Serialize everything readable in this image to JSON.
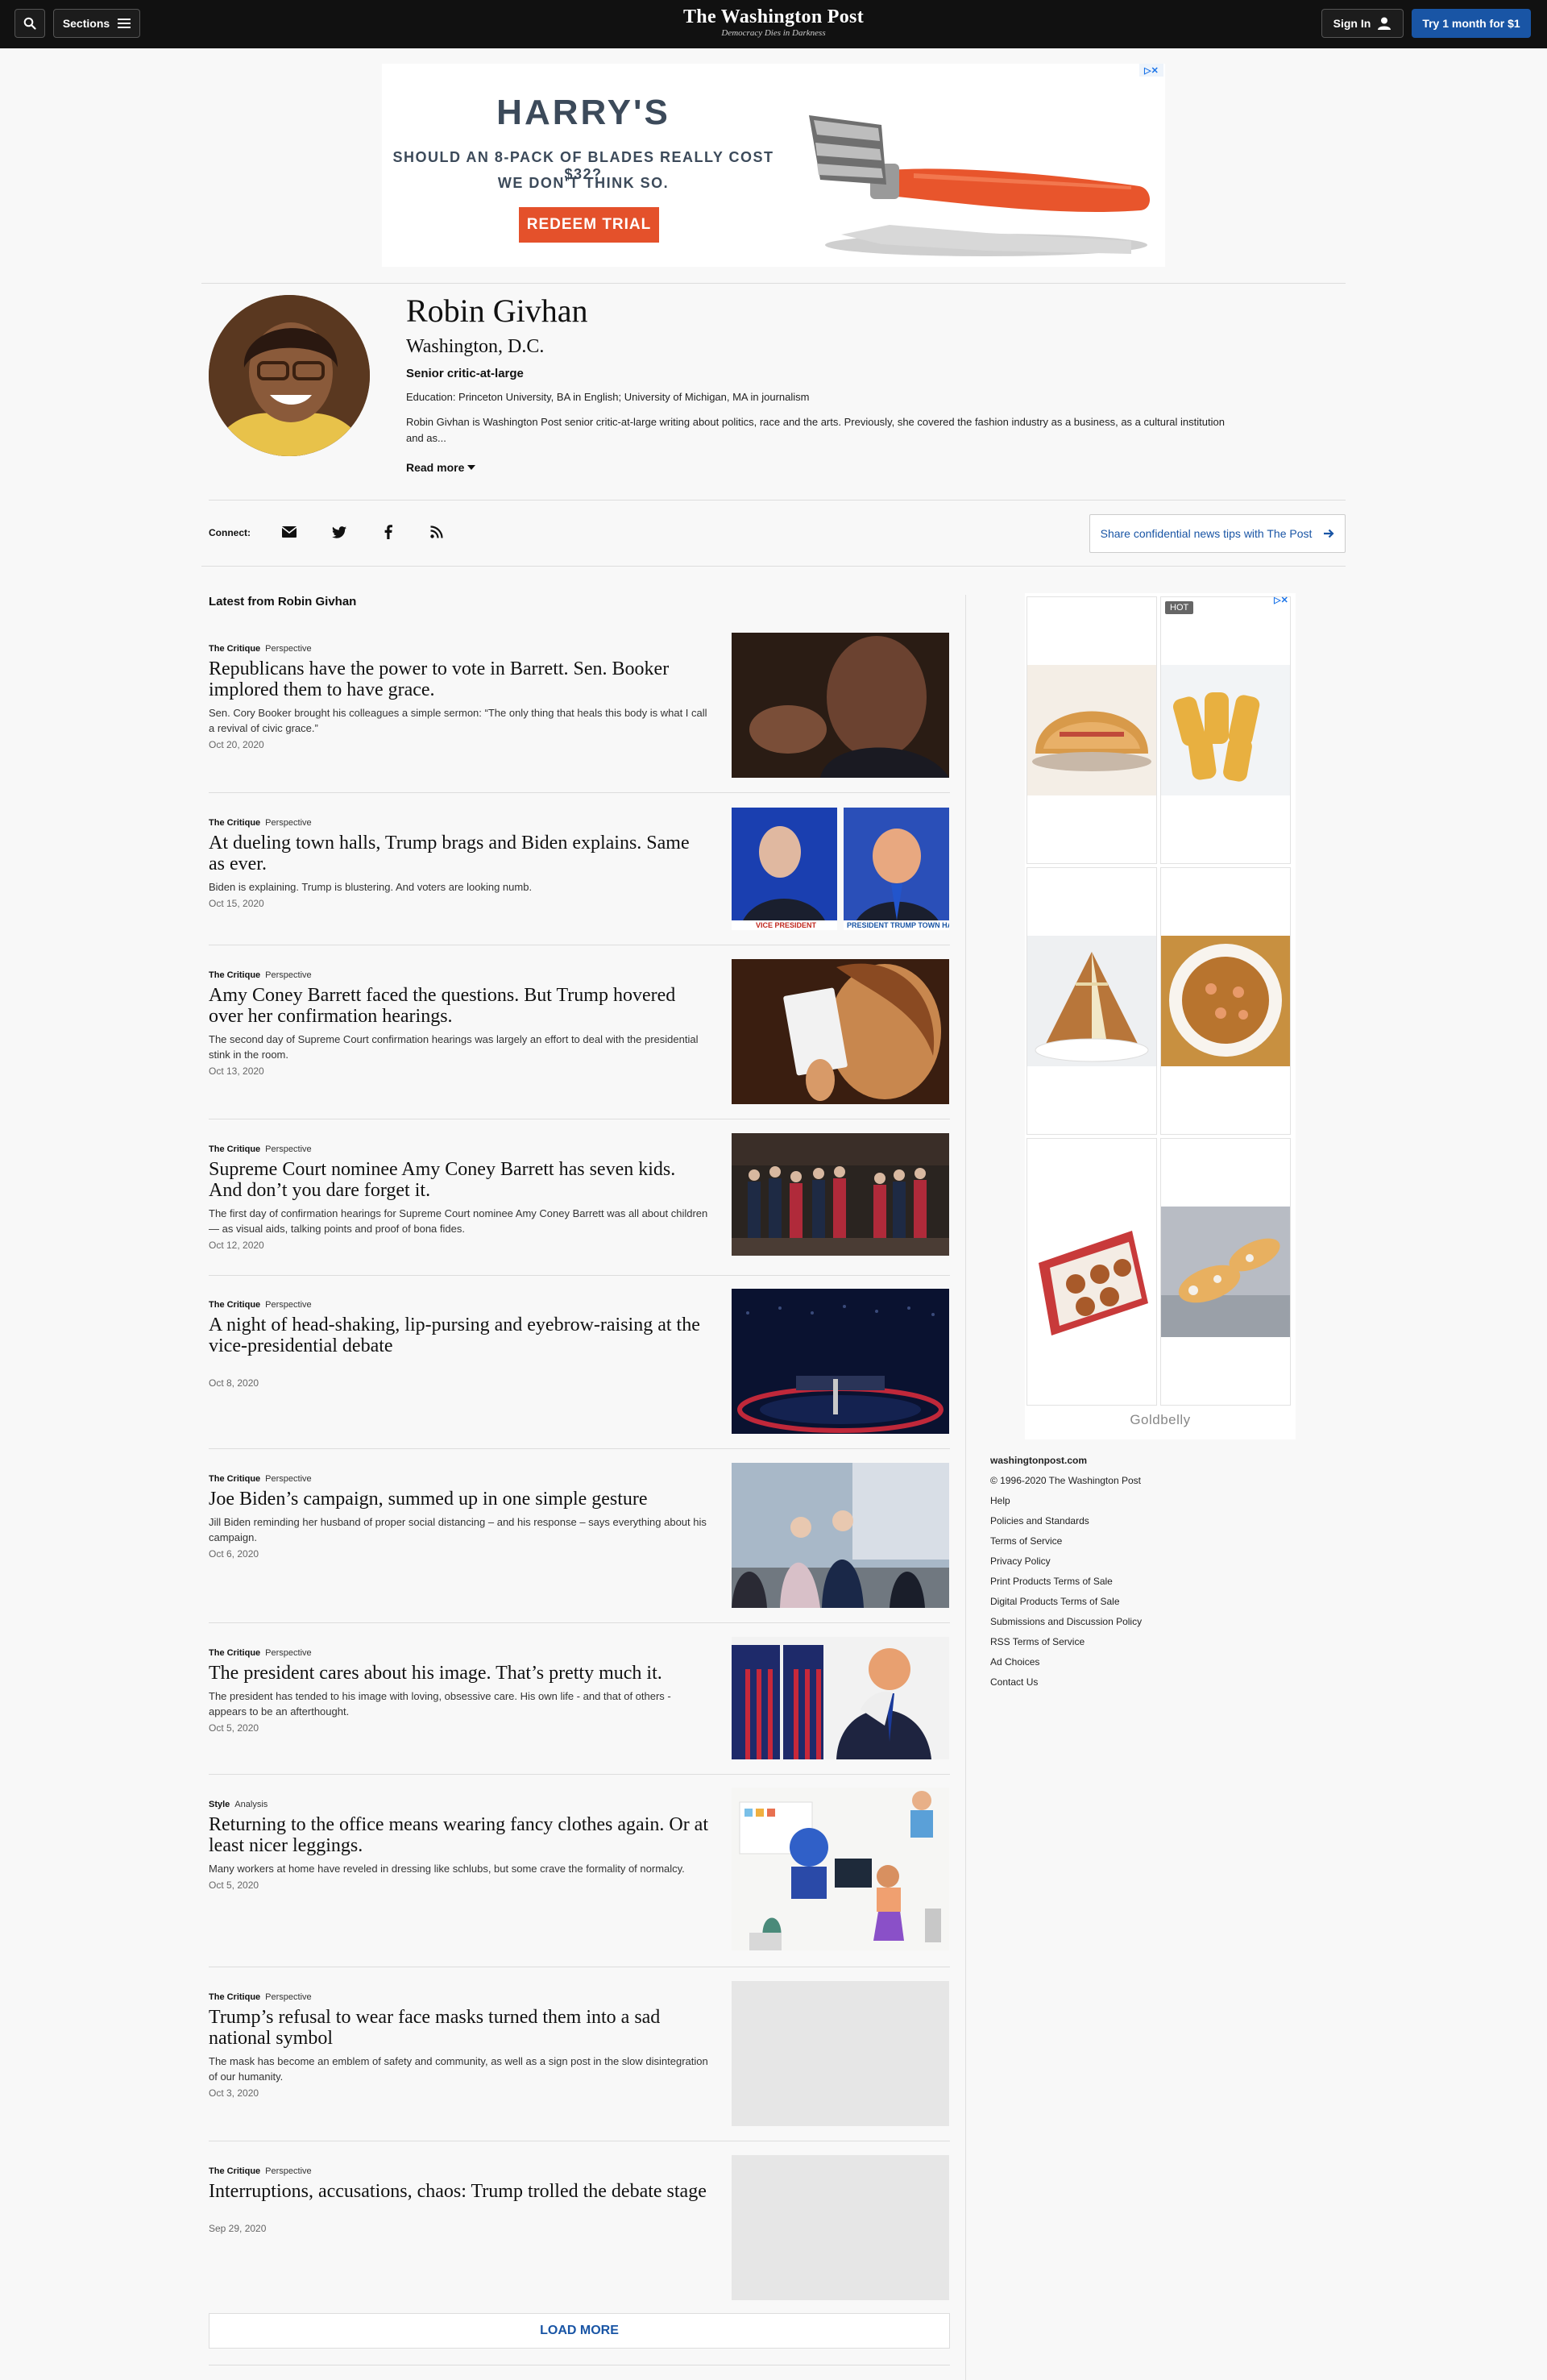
{
  "header": {
    "sections_label": "Sections",
    "logo_name": "The Washington Post",
    "logo_tagline": "Democracy Dies in Darkness",
    "signin_label": "Sign In",
    "trial_label": "Try 1 month for $1"
  },
  "top_ad": {
    "brand": "HARRY'S",
    "line1": "SHOULD AN 8-PACK OF BLADES REALLY COST $32?",
    "line2": "WE DON'T THINK SO.",
    "cta": "REDEEM TRIAL",
    "colors": {
      "cta": "#e4512b",
      "text": "#3c4a5a",
      "handle": "#e8552c"
    }
  },
  "profile": {
    "name": "Robin Givhan",
    "location": "Washington, D.C.",
    "role": "Senior critic-at-large",
    "education": "Education: Princeton University, BA in English; University of Michigan, MA in journalism",
    "bio": "Robin Givhan is Washington Post senior critic-at-large writing about politics, race and the arts. Previously, she covered the fashion industry as a business, as a cultural institution and as...",
    "read_more": "Read more"
  },
  "connect": {
    "label": "Connect:",
    "icons": [
      "email-icon",
      "twitter-icon",
      "facebook-icon",
      "rss-icon"
    ],
    "tips_label": "Share confidential news tips with The Post"
  },
  "latest_heading": "Latest from Robin Givhan",
  "articles": [
    {
      "section": "The Critique",
      "label": "Perspective",
      "headline": "Republicans have the power to vote in Barrett. Sen. Booker implored them to have grace.",
      "blurb": "Sen. Cory Booker brought his colleagues a simple sermon: “The only thing that heals this body is what I call a revival of civic grace.”",
      "date": "Oct 20, 2020"
    },
    {
      "section": "The Critique",
      "label": "Perspective",
      "headline": "At dueling town halls, Trump brags and Biden explains. Same as ever.",
      "blurb": "Biden is explaining. Trump is blustering. And voters are looking numb.",
      "date": "Oct 15, 2020"
    },
    {
      "section": "The Critique",
      "label": "Perspective",
      "headline": "Amy Coney Barrett faced the questions. But Trump hovered over her confirmation hearings.",
      "blurb": "The second day of Supreme Court confirmation hearings was largely an effort to deal with the presidential stink in the room.",
      "date": "Oct 13, 2020"
    },
    {
      "section": "The Critique",
      "label": "Perspective",
      "headline": "Supreme Court nominee Amy Coney Barrett has seven kids. And don’t you dare forget it.",
      "blurb": "The first day of confirmation hearings for Supreme Court nominee Amy Coney Barrett was all about children — as visual aids, talking points and proof of bona fides.",
      "date": "Oct 12, 2020"
    },
    {
      "section": "The Critique",
      "label": "Perspective",
      "headline": "A night of head-shaking, lip-pursing and eyebrow-raising at the vice-presidential debate",
      "blurb": "",
      "date": "Oct 8, 2020"
    },
    {
      "section": "The Critique",
      "label": "Perspective",
      "headline": "Joe Biden’s campaign, summed up in one simple gesture",
      "blurb": "Jill Biden reminding her husband of proper social distancing – and his response – says everything about his campaign.",
      "date": "Oct 6, 2020"
    },
    {
      "section": "The Critique",
      "label": "Perspective",
      "headline": "The president cares about his image. That’s pretty much it.",
      "blurb": "The president has tended to his image with loving, obsessive care. His own life - and that of others - appears to be an afterthought.",
      "date": "Oct 5, 2020"
    },
    {
      "section": "Style",
      "label": "Analysis",
      "headline": "Returning to the office means wearing fancy clothes again. Or at least nicer leggings.",
      "blurb": "Many workers at home have reveled in dressing like schlubs, but some crave the formality of normalcy.",
      "date": "Oct 5, 2020"
    },
    {
      "section": "The Critique",
      "label": "Perspective",
      "headline": "Trump’s refusal to wear face masks turned them into a sad national symbol",
      "blurb": "The mask has become an emblem of safety and community, as well as a sign post in the slow disintegration of our humanity.",
      "date": "Oct 3, 2020"
    },
    {
      "section": "The Critique",
      "label": "Perspective",
      "headline": "Interruptions, accusations, chaos: Trump trolled the debate stage",
      "blurb": "",
      "date": "Sep 29, 2020"
    }
  ],
  "thumb_banners": {
    "left": "VICE PRESIDENT",
    "right": "PRESIDENT TRUMP TOWN HA"
  },
  "load_more": "LOAD MORE",
  "right_ad": {
    "badge": "HOT",
    "brand": "Goldbelly"
  },
  "footer": {
    "site": "washingtonpost.com",
    "copyright": "© 1996-2020 The Washington Post",
    "links": [
      "Help",
      "Policies and Standards",
      "Terms of Service",
      "Privacy Policy",
      "Print Products Terms of Sale",
      "Digital Products Terms of Sale",
      "Submissions and Discussion Policy",
      "RSS Terms of Service",
      "Ad Choices",
      "Contact Us"
    ]
  }
}
